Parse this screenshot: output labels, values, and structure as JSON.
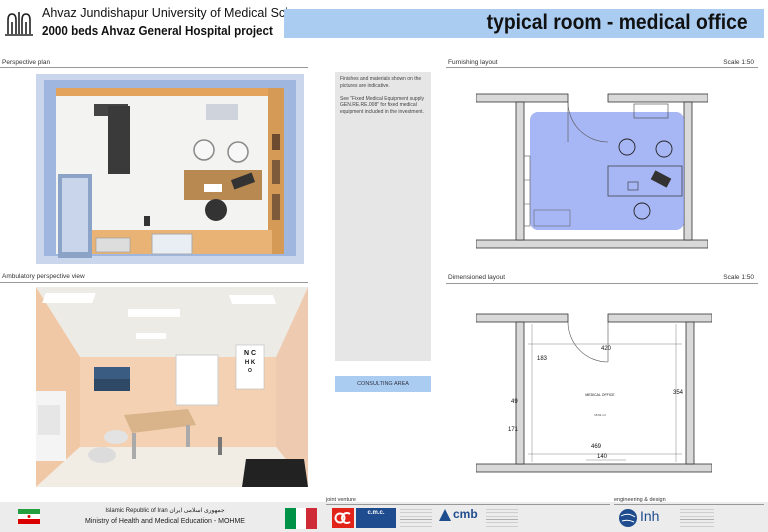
{
  "header": {
    "university": "Ahvaz Jundishapur University of Medical Sciences",
    "project": "2000 beds Ahvaz General Hospital project",
    "title": "typical room  - medical office"
  },
  "sections": {
    "perspective_plan": "Perspective plan",
    "ambulatory_view": "Ambulatory perspective view",
    "furnishing_layout": "Furnishing  layout",
    "furnishing_scale": "Scale 1:50",
    "dimensioned_layout": "Dimensioned layout",
    "dimensioned_scale": "Scale 1:50"
  },
  "notes": {
    "p1": "Finishes and materials  shown on the pictures are indicative.",
    "p2": "See \"Fixed Medical Equipment supply GEN.RE.RE.008\"  for  fixed medical equipment included in the investment."
  },
  "consulting_area": "CONSULTING AREA",
  "dimensions": {
    "top": "420",
    "left_upper": "183",
    "left_mid": "49",
    "left_lower": "171",
    "right": "354",
    "bottom": "469",
    "door": "140",
    "room_name": "MEDICAL OFFICE",
    "room_area": "15.61 m²"
  },
  "eye_chart": [
    "N C",
    "H K",
    "O"
  ],
  "footer": {
    "ministry_line1": "Islamic Republic of Iran  جمهوری اسلامی ایران",
    "ministry_line2": "Ministry of Health and Medical Education - MOHME",
    "joint_venture": "joint venture",
    "engineering": "engineering & design",
    "logo_cmc": "c.m.c.",
    "logo_cmb": "cmb",
    "logo_inh": "Inh"
  },
  "colors": {
    "accent_blue": "#a9ccf0",
    "furnish_blue": "#8a9ef0",
    "wall_gray": "#d9d9d9",
    "iran_green": "#239f40",
    "iran_red": "#da0000",
    "italy_green": "#009246",
    "italy_red": "#ce2b37"
  }
}
